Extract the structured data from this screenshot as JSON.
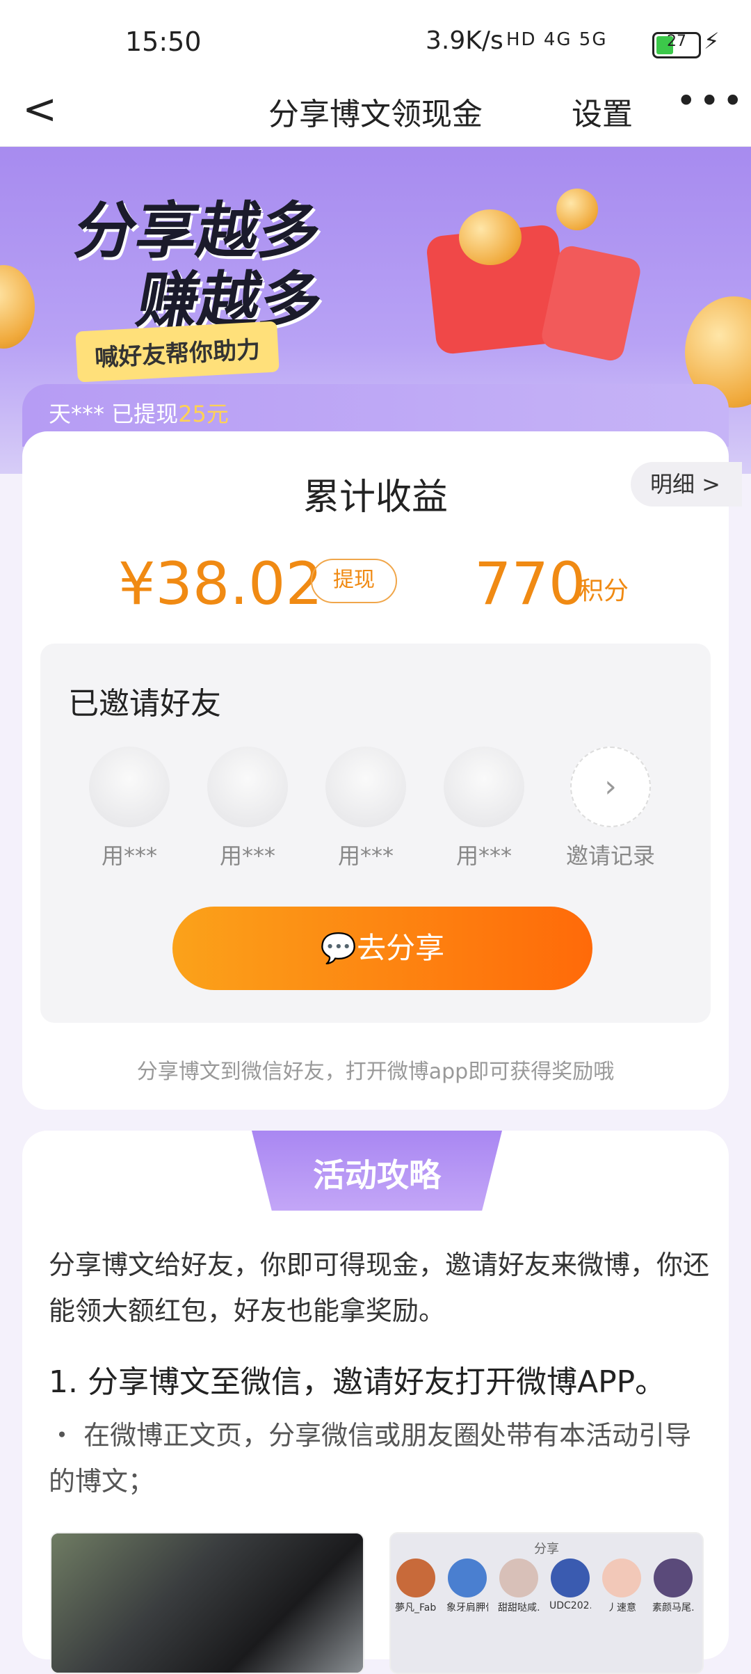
{
  "status": {
    "time": "15:50",
    "net_speed": "3.9K/s",
    "signals": "HD 4G 5G",
    "battery": "27"
  },
  "nav": {
    "back": "<",
    "title": "分享博文领现金",
    "settings": "设置",
    "more": "•••"
  },
  "banner": {
    "line1": "分享越多",
    "line2": "赚越多",
    "tag": "喊好友帮你助力"
  },
  "ticker": {
    "prefix": "天*** 已提现",
    "amount": "25元"
  },
  "earnings": {
    "title": "累计收益",
    "detail": "明细 >",
    "money": "¥38.02",
    "withdraw": "提现",
    "points": "770",
    "points_unit": "积分"
  },
  "friends": {
    "title": "已邀请好友",
    "items": [
      {
        "name": "用***"
      },
      {
        "name": "用***"
      },
      {
        "name": "用***"
      },
      {
        "name": "用***"
      }
    ],
    "record": "邀请记录",
    "share_button": "去分享",
    "hint": "分享博文到微信好友，打开微博app即可获得奖励哦"
  },
  "guide": {
    "ribbon": "活动攻略",
    "para": "分享博文给好友，你即可得现金，邀请好友来微博，你还能领大额红包，好友也能拿奖励。",
    "step1": "1. 分享博文至微信，邀请好友打开微博APP。",
    "bullet1": "・ 在微博正文页，分享微信或朋友圈处带有本活动引导的博文；",
    "thumb_label": "分享",
    "mini_users": [
      "夢凡_Fab…",
      "象牙肩胛骨",
      "甜甜哒咸…",
      "UDC202…",
      "丿速意",
      "素颜马尾…"
    ]
  }
}
